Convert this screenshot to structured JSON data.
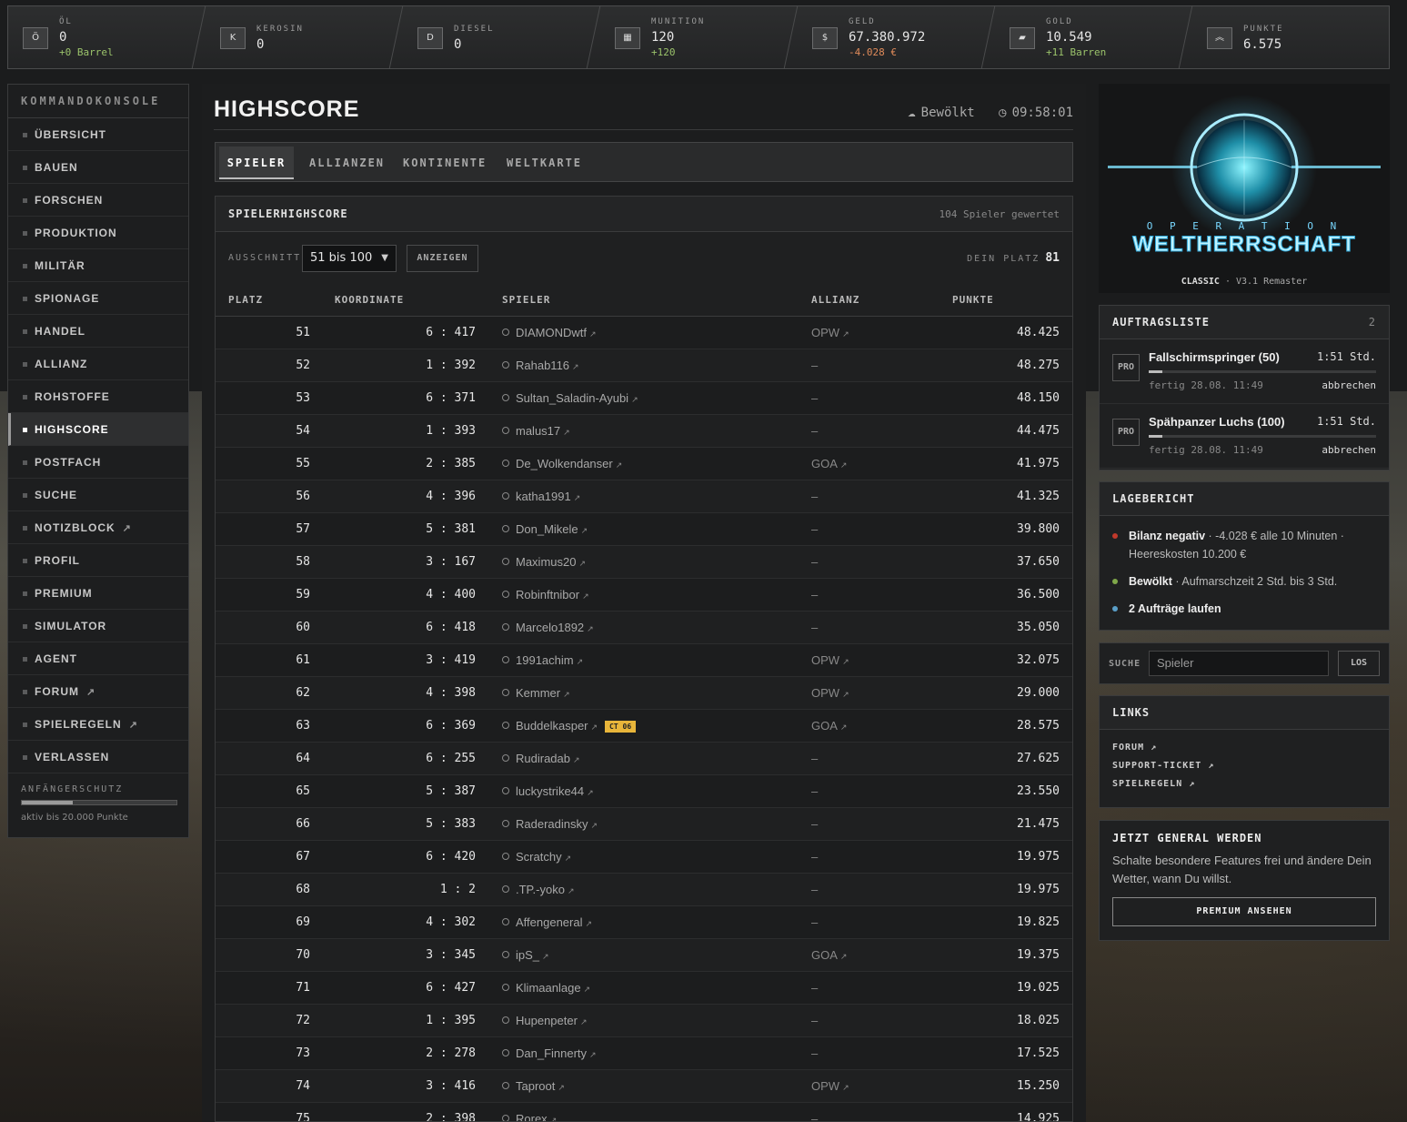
{
  "resources": [
    {
      "label": "ÖL",
      "value": "0",
      "sub": "+0 Barrel",
      "sub_class": "pos",
      "icon": "oil-barrel-icon",
      "glyph": "Ö"
    },
    {
      "label": "KEROSIN",
      "value": "0",
      "sub": "",
      "sub_class": "",
      "icon": "kerosene-icon",
      "glyph": "K"
    },
    {
      "label": "DIESEL",
      "value": "0",
      "sub": "",
      "sub_class": "",
      "icon": "diesel-icon",
      "glyph": "D"
    },
    {
      "label": "MUNITION",
      "value": "120",
      "sub": "+120",
      "sub_class": "pos",
      "icon": "ammo-icon",
      "glyph": "▦"
    },
    {
      "label": "GELD",
      "value": "67.380.972",
      "sub": "-4.028 €",
      "sub_class": "neg",
      "icon": "money-icon",
      "glyph": "$"
    },
    {
      "label": "GOLD",
      "value": "10.549",
      "sub": "+11 Barren",
      "sub_class": "pos",
      "icon": "gold-bar-icon",
      "glyph": "▰"
    },
    {
      "label": "PUNKTE",
      "value": "6.575",
      "sub": "",
      "sub_class": "",
      "icon": "rank-chevron-icon",
      "glyph": "︽"
    }
  ],
  "sidebar": {
    "header": "KOMMANDOKONSOLE",
    "items": [
      {
        "label": "ÜBERSICHT",
        "ext": false
      },
      {
        "label": "BAUEN",
        "ext": false
      },
      {
        "label": "FORSCHEN",
        "ext": false
      },
      {
        "label": "PRODUKTION",
        "ext": false
      },
      {
        "label": "MILITÄR",
        "ext": false
      },
      {
        "label": "SPIONAGE",
        "ext": false
      },
      {
        "label": "HANDEL",
        "ext": false
      },
      {
        "label": "ALLIANZ",
        "ext": false
      },
      {
        "label": "ROHSTOFFE",
        "ext": false
      },
      {
        "label": "HIGHSCORE",
        "ext": false,
        "active": true
      },
      {
        "label": "POSTFACH",
        "ext": false
      },
      {
        "label": "SUCHE",
        "ext": false
      },
      {
        "label": "NOTIZBLOCK",
        "ext": true
      },
      {
        "label": "PROFIL",
        "ext": false
      },
      {
        "label": "PREMIUM",
        "ext": false
      },
      {
        "label": "SIMULATOR",
        "ext": false
      },
      {
        "label": "AGENT",
        "ext": false
      },
      {
        "label": "FORUM",
        "ext": true
      },
      {
        "label": "SPIELREGELN",
        "ext": true
      },
      {
        "label": "VERLASSEN",
        "ext": false
      }
    ],
    "protection_label": "ANFÄNGERSCHUTZ",
    "protection_fraction": 0.33,
    "protection_text": "aktiv bis 20.000 Punkte"
  },
  "page": {
    "title": "HIGHSCORE",
    "weather": "Bewölkt",
    "clock": "09:58:01",
    "tabs": [
      {
        "label": "SPIELER",
        "active": true
      },
      {
        "label": "ALLIANZEN"
      },
      {
        "label": "KONTINENTE"
      },
      {
        "label": "WELTKARTE"
      }
    ]
  },
  "highscore": {
    "title": "SPIELERHIGHSCORE",
    "count": "104 Spieler gewertet",
    "filter_label": "AUSSCHNITT",
    "filter_value": "51 bis 100",
    "show_button": "ANZEIGEN",
    "my_rank_label": "DEIN PLATZ",
    "my_rank": "81",
    "columns": {
      "rank": "PLATZ",
      "coord": "KOORDINATE",
      "player": "SPIELER",
      "alliance": "ALLIANZ",
      "points": "PUNKTE"
    },
    "rows": [
      {
        "rank": "51",
        "coord": "6 : 417",
        "player": "DIAMONDwtf",
        "alliance": "OPW",
        "points": "48.425"
      },
      {
        "rank": "52",
        "coord": "1 : 392",
        "player": "Rahab116",
        "alliance": "–",
        "points": "48.275"
      },
      {
        "rank": "53",
        "coord": "6 : 371",
        "player": "Sultan_Saladin-Ayubi",
        "alliance": "–",
        "points": "48.150"
      },
      {
        "rank": "54",
        "coord": "1 : 393",
        "player": "malus17",
        "alliance": "–",
        "points": "44.475"
      },
      {
        "rank": "55",
        "coord": "2 : 385",
        "player": "De_Wolkendanser",
        "alliance": "GOA",
        "points": "41.975"
      },
      {
        "rank": "56",
        "coord": "4 : 396",
        "player": "katha1991",
        "alliance": "–",
        "points": "41.325"
      },
      {
        "rank": "57",
        "coord": "5 : 381",
        "player": "Don_Mikele",
        "alliance": "–",
        "points": "39.800"
      },
      {
        "rank": "58",
        "coord": "3 : 167",
        "player": "Maximus20",
        "alliance": "–",
        "points": "37.650"
      },
      {
        "rank": "59",
        "coord": "4 : 400",
        "player": "Robinftnibor",
        "alliance": "–",
        "points": "36.500"
      },
      {
        "rank": "60",
        "coord": "6 : 418",
        "player": "Marcelo1892",
        "alliance": "–",
        "points": "35.050"
      },
      {
        "rank": "61",
        "coord": "3 : 419",
        "player": "1991achim",
        "alliance": "OPW",
        "points": "32.075"
      },
      {
        "rank": "62",
        "coord": "4 : 398",
        "player": "Kemmer",
        "alliance": "OPW",
        "points": "29.000"
      },
      {
        "rank": "63",
        "coord": "6 : 369",
        "player": "Buddelkasper",
        "alliance": "GOA",
        "points": "28.575",
        "badge": "CT 06"
      },
      {
        "rank": "64",
        "coord": "6 : 255",
        "player": "Rudiradab",
        "alliance": "–",
        "points": "27.625"
      },
      {
        "rank": "65",
        "coord": "5 : 387",
        "player": "luckystrike44",
        "alliance": "–",
        "points": "23.550"
      },
      {
        "rank": "66",
        "coord": "5 : 383",
        "player": "Raderadinsky",
        "alliance": "–",
        "points": "21.475"
      },
      {
        "rank": "67",
        "coord": "6 : 420",
        "player": "Scratchy",
        "alliance": "–",
        "points": "19.975"
      },
      {
        "rank": "68",
        "coord": "1 : 2",
        "player": ".TP.-yoko",
        "alliance": "–",
        "points": "19.975"
      },
      {
        "rank": "69",
        "coord": "4 : 302",
        "player": "Affengeneral",
        "alliance": "–",
        "points": "19.825"
      },
      {
        "rank": "70",
        "coord": "3 : 345",
        "player": "ipS_",
        "alliance": "GOA",
        "points": "19.375"
      },
      {
        "rank": "71",
        "coord": "6 : 427",
        "player": "Klimaanlage",
        "alliance": "–",
        "points": "19.025"
      },
      {
        "rank": "72",
        "coord": "1 : 395",
        "player": "Hupenpeter",
        "alliance": "–",
        "points": "18.025"
      },
      {
        "rank": "73",
        "coord": "2 : 278",
        "player": "Dan_Finnerty",
        "alliance": "–",
        "points": "17.525"
      },
      {
        "rank": "74",
        "coord": "3 : 416",
        "player": "Taproot",
        "alliance": "OPW",
        "points": "15.250"
      },
      {
        "rank": "75",
        "coord": "2 : 398",
        "player": "Rorex",
        "alliance": "–",
        "points": "14.925"
      }
    ]
  },
  "logo": {
    "line1": "O P E R A T I O N",
    "line2": "WELTHERRSCHAFT",
    "edition": "CLASSIC",
    "version": "· V3.1 Remaster"
  },
  "orders": {
    "title": "AUFTRAGSLISTE",
    "count": "2",
    "items": [
      {
        "tag": "PRO",
        "name": "Fallschirmspringer (50)",
        "time": "1:51 Std.",
        "done": "fertig 28.08. 11:49",
        "cancel": "abbrechen"
      },
      {
        "tag": "PRO",
        "name": "Spähpanzer Luchs (100)",
        "time": "1:51 Std.",
        "done": "fertig 28.08. 11:49",
        "cancel": "abbrechen"
      }
    ]
  },
  "report": {
    "title": "LAGEBERICHT",
    "items": [
      {
        "bold": "Bilanz negativ",
        "text": " · -4.028 € alle 10 Minuten · Heereskosten 10.200 €",
        "color": "#c0392b"
      },
      {
        "bold": "Bewölkt",
        "text": " · Aufmarschzeit 2 Std. bis 3 Std.",
        "color": "#7fa84a"
      },
      {
        "bold": "2 Aufträge laufen",
        "text": "",
        "color": "#5a9fc8"
      }
    ]
  },
  "search": {
    "label": "SUCHE",
    "placeholder": "Spieler",
    "button": "LOS"
  },
  "links": {
    "title": "LINKS",
    "items": [
      "FORUM ↗",
      "SUPPORT-TICKET ↗",
      "SPIELREGELN ↗"
    ]
  },
  "premium": {
    "title": "JETZT GENERAL WERDEN",
    "text": "Schalte besondere Features frei und ändere Dein Wetter, wann Du willst.",
    "button": "PREMIUM ANSEHEN"
  }
}
